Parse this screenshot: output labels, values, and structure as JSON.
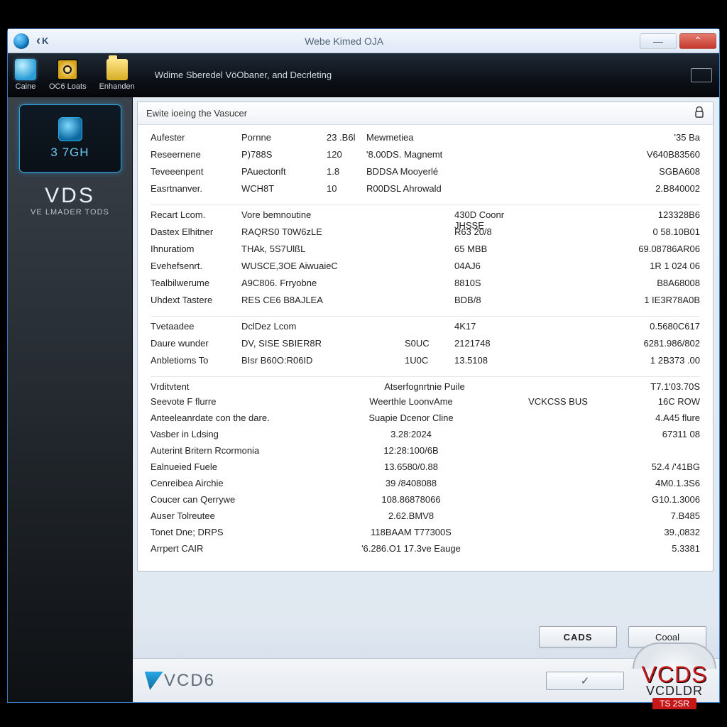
{
  "titlebar": {
    "back_label": "K",
    "title": "Webe Kimed OJA"
  },
  "toolbar": {
    "items": [
      {
        "name": "caine",
        "label": "Caine"
      },
      {
        "name": "ccloats",
        "label": "OC6 Loats"
      },
      {
        "name": "enhander",
        "label": "Enhanden"
      }
    ],
    "tabstrip": "Wdime   Sberedel VöObaner,  and Decrleting"
  },
  "sidebar": {
    "chip_label": "3 7GH",
    "brand": "VDS",
    "brand_sub": "VE LMADER TODS"
  },
  "panel": {
    "heading": "Ewite ioeing the Vasucer",
    "block_a": [
      {
        "label": "Aufester",
        "code": "Pornne",
        "num": "23 .B6l",
        "desc": "Mewmetiea",
        "val": "'35 Ba"
      },
      {
        "label": "Reseernene",
        "code": "P)788S",
        "num": "120",
        "desc": "'8.00DS. Magnemt",
        "val": "V640B83560"
      },
      {
        "label": "Teveeenpent",
        "code": "PAuectonft",
        "num": "1.8",
        "desc": "BDDSA Mooyerlé",
        "val": "SGBA608"
      },
      {
        "label": "Easrtnanver.",
        "code": "WCH8T",
        "num": "10",
        "desc": "R00DSL Ahrowald",
        "val": "2.B840002"
      }
    ],
    "block_b": [
      {
        "label": "Recart Lcom.",
        "code": "Vore bemnoutine",
        "mid": "",
        "num": "430D Coonr JHSSE",
        "val": "123328B6"
      },
      {
        "label": "Dastex Elhitner",
        "code": "RAQRS0 T0W6zLE",
        "mid": "",
        "num": "R63 20/8",
        "val": "0 58.10B01"
      },
      {
        "label": "Ihnuratiom",
        "code": "THAk, 5S7UlßL",
        "mid": "",
        "num": "65 MBB",
        "val": "69.08786AR06"
      },
      {
        "label": "Evehefsenrt.",
        "code": "WUSCE,3OE AiwuaieC",
        "mid": "",
        "num": "04AJ6",
        "val": "1R 1 024 06"
      },
      {
        "label": "Tealbilwerume",
        "code": "A9C806. Frryobne",
        "mid": "",
        "num": "8810S",
        "val": "B8A68008"
      },
      {
        "label": "Uhdext Tastere",
        "code": "RES CE6 B8AJLEA",
        "mid": "",
        "num": "BDB/8",
        "val": "1 IE3R78A0B"
      }
    ],
    "block_c": [
      {
        "label": "Tvetaadee",
        "code": "DclDez Lcom",
        "mid": "",
        "num": "4K17",
        "val": "0.5680C617"
      },
      {
        "label": "Daure wunder",
        "code": "DV, SISE SBIER8R",
        "mid": "S0UC",
        "num": "2121748",
        "val": "6281.986/802"
      },
      {
        "label": "Anbletioms To",
        "code": "BIsr B60O:R06ID",
        "mid": "1U0C",
        "num": "13.5108",
        "val": "1 2B373 .00"
      }
    ],
    "block_d_header": {
      "label": "Vrditvtent",
      "desc": "Atserfognrtnie Puile",
      "val": "T7.1'03.70S"
    },
    "block_d": [
      {
        "label": "Seevote F flurre",
        "mid": "Weerthle LoonvAme",
        "extra": "VCKCSS BUS",
        "val": "16C ROW"
      },
      {
        "label": "Anteeleanrdate con the dare.",
        "mid": "Suapie Dcenor Cline",
        "extra": "",
        "val": "4.A45 flure"
      },
      {
        "label": "Vasber in Ldsing",
        "mid": "3.28:2024",
        "extra": "",
        "val": "67311 08"
      },
      {
        "label": "Auterint Britern Rcormonia",
        "mid": "12:28:100/6B",
        "extra": "",
        "val": ""
      },
      {
        "label": "Ealnueied Fuele",
        "mid": "13.6580/0.88",
        "extra": "",
        "val": "52.4 /'41BG"
      },
      {
        "label": "Cenreibea Airchie",
        "mid": "39 /8408088",
        "extra": "",
        "val": "4M0.1.3S6"
      },
      {
        "label": "Coucer can Qerrywe",
        "mid": "108.86878066",
        "extra": "",
        "val": "G10.1.3006"
      },
      {
        "label": "Auser Tolreutee",
        "mid": "2.62.BMV8",
        "extra": "",
        "val": "7.B485"
      },
      {
        "label": "Tonet Dne; DRPS",
        "mid": "118BAAM  T77300S",
        "extra": "",
        "val": "39.,0832"
      },
      {
        "label": "Arrpert CAIR",
        "mid": "'6.286.O1  17.3ve Eauge",
        "extra": "",
        "val": "5.3381"
      }
    ]
  },
  "actions": {
    "primary": "CADS",
    "secondary": "Cooal"
  },
  "footer": {
    "left_brand": "VCD6",
    "confirm_glyph": "✓",
    "badge_big": "VCDS",
    "badge_small": "VCDLDR",
    "badge_bar": "TS 2SR"
  }
}
